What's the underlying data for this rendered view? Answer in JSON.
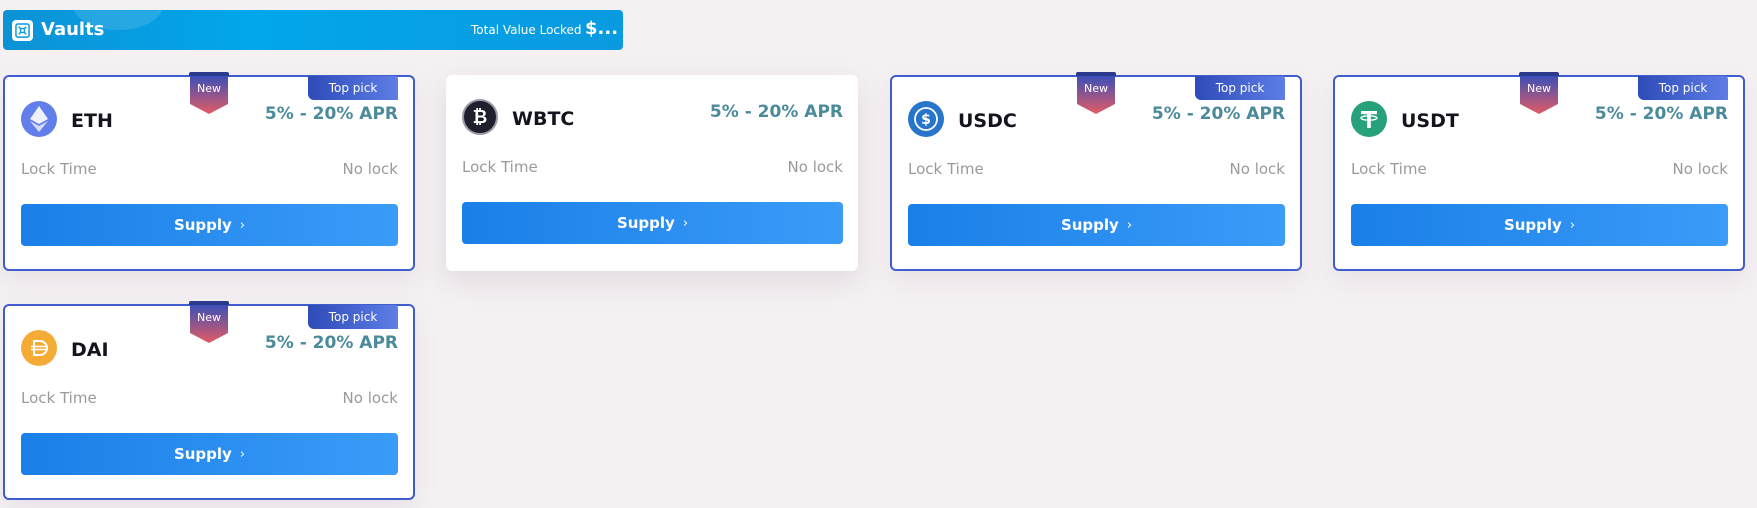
{
  "header": {
    "title": "Vaults",
    "tvl_label": "Total Value Locked",
    "tvl_value": "$..."
  },
  "common": {
    "lock_label": "Lock Time",
    "supply_label": "Supply",
    "new_badge": "New",
    "top_pick_badge": "Top pick"
  },
  "vaults": [
    {
      "name": "ETH",
      "apr": "5% - 20% APR",
      "lock": "No lock",
      "icon": "eth-icon",
      "color": "#627eea",
      "new": true,
      "top_pick": true
    },
    {
      "name": "WBTC",
      "apr": "5% - 20% APR",
      "lock": "No lock",
      "icon": "wbtc-icon",
      "color": "#1f1f2e",
      "new": false,
      "top_pick": false
    },
    {
      "name": "USDC",
      "apr": "5% - 20% APR",
      "lock": "No lock",
      "icon": "usdc-icon",
      "color": "#2775ca",
      "new": true,
      "top_pick": true
    },
    {
      "name": "USDT",
      "apr": "5% - 20% APR",
      "lock": "No lock",
      "icon": "usdt-icon",
      "color": "#26a17b",
      "new": true,
      "top_pick": true
    },
    {
      "name": "DAI",
      "apr": "5% - 20% APR",
      "lock": "No lock",
      "icon": "dai-icon",
      "color": "#f5ac37",
      "new": true,
      "top_pick": true
    }
  ]
}
